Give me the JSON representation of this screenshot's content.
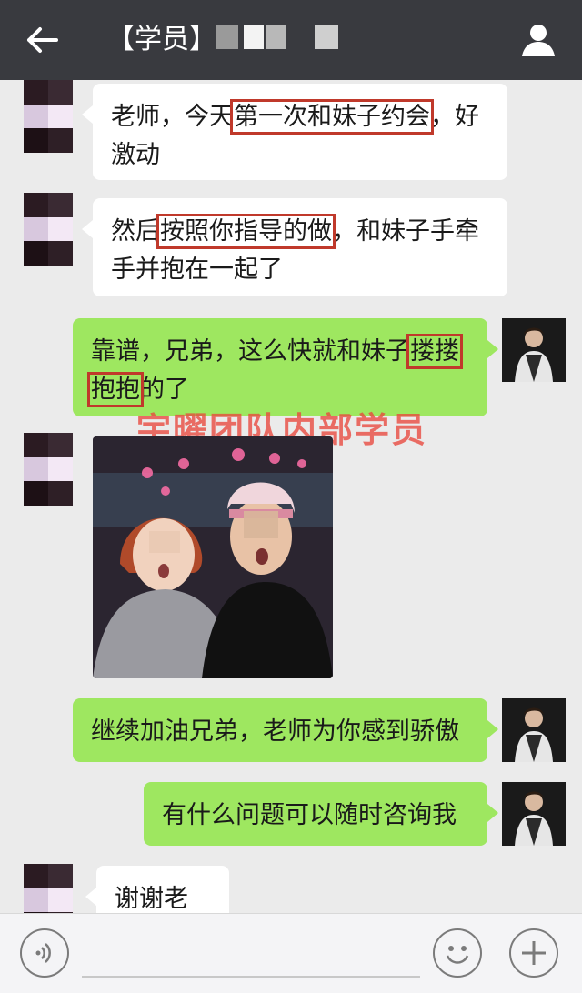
{
  "header": {
    "back_icon": "arrow-left-icon",
    "title": "【学员】",
    "contact_icon": "person-icon"
  },
  "messages": [
    {
      "side": "left",
      "text_before": "老师，今天",
      "highlight": "第一次和妹子约会",
      "text_after": "，好激动"
    },
    {
      "side": "left",
      "text_before": "然后",
      "highlight": "按照你指导的做",
      "text_after": "，和妹子手牵手并抱在一起了"
    },
    {
      "side": "right",
      "text_before": "靠谱，兄弟，这么快就和妹子",
      "highlight": "搂搂抱抱",
      "text_after": "的了"
    },
    {
      "side": "left",
      "type": "image",
      "content": "photo"
    },
    {
      "side": "right",
      "text": "继续加油兄弟，老师为你感到骄傲"
    },
    {
      "side": "right",
      "text": "有什么问题可以随时咨询我"
    },
    {
      "side": "left",
      "text": "谢谢老师"
    }
  ],
  "watermark": "宇曜团队内部学员",
  "input_bar": {
    "voice_icon": "voice-icon",
    "emoji_icon": "emoji-icon",
    "plus_icon": "plus-icon"
  },
  "colors": {
    "titlebar": "#393a3f",
    "background": "#ebebeb",
    "bubble_left": "#ffffff",
    "bubble_right": "#9ee760",
    "highlight_box": "#c0392b",
    "watermark": "#e8463c"
  }
}
